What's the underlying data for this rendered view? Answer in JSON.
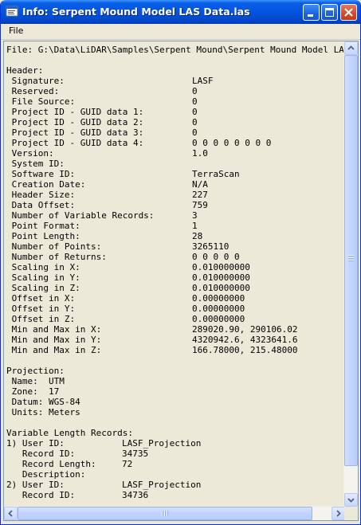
{
  "window": {
    "title": "Info: Serpent Mound Model LAS Data.las"
  },
  "menu": {
    "file_label": "File"
  },
  "info": {
    "file_line": "File: G:\\Data\\LiDAR\\Samples\\Serpent Mound\\Serpent Mound Model LAS Data.las",
    "header_title": "Header:",
    "header_fields": [
      {
        "label": " Signature:",
        "value": "LASF"
      },
      {
        "label": " Reserved:",
        "value": "0"
      },
      {
        "label": " File Source:",
        "value": "0"
      },
      {
        "label": " Project ID - GUID data 1:",
        "value": "0"
      },
      {
        "label": " Project ID - GUID data 2:",
        "value": "0"
      },
      {
        "label": " Project ID - GUID data 3:",
        "value": "0"
      },
      {
        "label": " Project ID - GUID data 4:",
        "value": "0 0 0 0 0 0 0 0"
      },
      {
        "label": " Version:",
        "value": "1.0"
      },
      {
        "label": " System ID:",
        "value": ""
      },
      {
        "label": " Software ID:",
        "value": "TerraScan"
      },
      {
        "label": " Creation Date:",
        "value": "N/A"
      },
      {
        "label": " Header Size:",
        "value": "227"
      },
      {
        "label": " Data Offset:",
        "value": "759"
      },
      {
        "label": " Number of Variable Records:",
        "value": "3"
      },
      {
        "label": " Point Format:",
        "value": "1"
      },
      {
        "label": " Point Length:",
        "value": "28"
      },
      {
        "label": " Number of Points:",
        "value": "3265110"
      },
      {
        "label": " Number of Returns:",
        "value": "0 0 0 0 0"
      },
      {
        "label": " Scaling in X:",
        "value": "0.010000000"
      },
      {
        "label": " Scaling in Y:",
        "value": "0.010000000"
      },
      {
        "label": " Scaling in Z:",
        "value": "0.010000000"
      },
      {
        "label": " Offset in X:",
        "value": "0.00000000"
      },
      {
        "label": " Offset in Y:",
        "value": "0.00000000"
      },
      {
        "label": " Offset in Z:",
        "value": "0.00000000"
      },
      {
        "label": " Min and Max in X:",
        "value": "289020.90, 290106.02"
      },
      {
        "label": " Min and Max in Y:",
        "value": "4320942.6, 4323641.6"
      },
      {
        "label": " Min and Max in Z:",
        "value": "166.78000, 215.48000"
      }
    ],
    "projection_title": "Projection:",
    "projection_lines": [
      " Name:  UTM",
      " Zone:  17",
      " Datum: WGS-84",
      " Units: Meters"
    ],
    "vlr_title": "Variable Length Records:",
    "vlr_lines": [
      {
        "label": "1) User ID:",
        "value": "LASF_Projection"
      },
      {
        "label": "   Record ID:",
        "value": "34735"
      },
      {
        "label": "   Record Length:",
        "value": "72"
      },
      {
        "label": "   Description:",
        "value": ""
      },
      {
        "label": "2) User ID:",
        "value": "LASF_Projection"
      },
      {
        "label": "   Record ID:",
        "value": "34736"
      }
    ]
  },
  "icons": {
    "app": "window-app-icon",
    "minimize": "minimize-icon",
    "maximize": "maximize-icon",
    "close": "close-icon"
  },
  "colors": {
    "title_bar": "#0454e0",
    "close_button": "#d4492b",
    "window_bg": "#ece9d8"
  }
}
